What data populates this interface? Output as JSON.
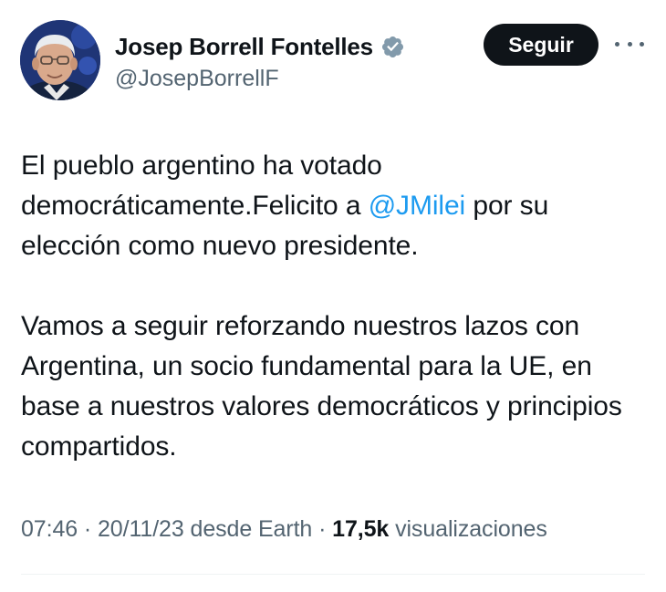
{
  "tweet": {
    "author": {
      "display_name": "Josep Borrell Fontelles",
      "handle": "@JosepBorrellF",
      "verified_icon": "verified-badge-icon"
    },
    "follow_label": "Seguir",
    "more_icon": "more-options-icon",
    "paragraph1": {
      "part1": "El pueblo argentino ha votado democráticamente.Felicito a ",
      "mention": "@JMilei",
      "part2": " por su elección como nuevo presidente."
    },
    "paragraph2": "Vamos a seguir reforzando nuestros lazos con Argentina, un socio fundamental para la UE, en base a nuestros valores democráticos y principios compartidos.",
    "meta": {
      "time": "07:46",
      "date": "20/11/23",
      "source": "desde Earth",
      "separator": " · ",
      "views_count": "17,5k",
      "views_label": "visualizaciones"
    }
  },
  "colors": {
    "text": "#0f1419",
    "secondary": "#536471",
    "link": "#1d9bf0",
    "button_bg": "#0f1419",
    "verified_badge": "#829aab"
  }
}
